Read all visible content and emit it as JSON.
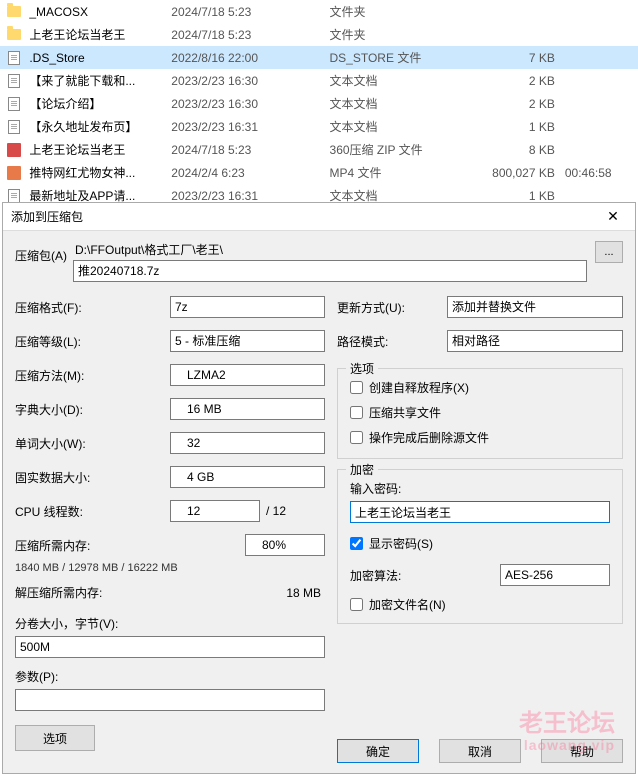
{
  "files": [
    {
      "icon": "folder",
      "name": "_MACOSX",
      "date": "2024/7/18 5:23",
      "type": "文件夹",
      "size": "",
      "dur": ""
    },
    {
      "icon": "folder",
      "name": "上老王论坛当老王",
      "date": "2024/7/18 5:23",
      "type": "文件夹",
      "size": "",
      "dur": ""
    },
    {
      "icon": "doc",
      "name": ".DS_Store",
      "date": "2022/8/16 22:00",
      "type": "DS_STORE 文件",
      "size": "7 KB",
      "dur": "",
      "selected": true
    },
    {
      "icon": "doc",
      "name": "【来了就能下载和...",
      "date": "2023/2/23 16:30",
      "type": "文本文档",
      "size": "2 KB",
      "dur": ""
    },
    {
      "icon": "doc",
      "name": "【论坛介绍】",
      "date": "2023/2/23 16:30",
      "type": "文本文档",
      "size": "2 KB",
      "dur": ""
    },
    {
      "icon": "doc",
      "name": "【永久地址发布页】",
      "date": "2023/2/23 16:31",
      "type": "文本文档",
      "size": "1 KB",
      "dur": ""
    },
    {
      "icon": "zip",
      "name": "上老王论坛当老王",
      "date": "2024/7/18 5:23",
      "type": "360压缩 ZIP 文件",
      "size": "8 KB",
      "dur": ""
    },
    {
      "icon": "mp4",
      "name": "推特网红尤物女神...",
      "date": "2024/2/4 6:23",
      "type": "MP4 文件",
      "size": "800,027 KB",
      "dur": "00:46:58"
    },
    {
      "icon": "doc",
      "name": "最新地址及APP请...",
      "date": "2023/2/23 16:31",
      "type": "文本文档",
      "size": "1 KB",
      "dur": ""
    }
  ],
  "dialog": {
    "title": "添加到压缩包",
    "archive_label": "压缩包(A)",
    "archive_path": "D:\\FFOutput\\格式工厂\\老王\\",
    "archive_name": "推20240718.7z",
    "browse": "...",
    "format_label": "压缩格式(F):",
    "format_value": "7z",
    "level_label": "压缩等级(L):",
    "level_value": "5 - 标准压缩",
    "method_label": "压缩方法(M):",
    "method_value": "LZMA2",
    "dict_label": "字典大小(D):",
    "dict_value": "16 MB",
    "word_label": "单词大小(W):",
    "word_value": "32",
    "solid_label": "固实数据大小:",
    "solid_value": "4 GB",
    "cpu_label": "CPU 线程数:",
    "cpu_value": "12",
    "cpu_max": "/ 12",
    "mem_comp_label": "压缩所需内存:",
    "mem_comp_value": "80%",
    "mem_comp_text": "1840 MB / 12978 MB / 16222 MB",
    "mem_decomp_label": "解压缩所需内存:",
    "mem_decomp_value": "18 MB",
    "split_label": "分卷大小，字节(V):",
    "split_value": "500M",
    "param_label": "参数(P):",
    "param_value": "",
    "options_btn": "选项",
    "update_label": "更新方式(U):",
    "update_value": "添加并替换文件",
    "pathmode_label": "路径模式:",
    "pathmode_value": "相对路径",
    "opts_title": "选项",
    "opt_sfx": "创建自释放程序(X)",
    "opt_share": "压缩共享文件",
    "opt_delete": "操作完成后删除源文件",
    "enc_title": "加密",
    "pw_label": "输入密码:",
    "pw_value": "上老王论坛当老王",
    "show_pw": "显示密码(S)",
    "enc_algo_label": "加密算法:",
    "enc_algo_value": "AES-256",
    "enc_names": "加密文件名(N)",
    "btn_ok": "确定",
    "btn_cancel": "取消",
    "btn_help": "帮助"
  },
  "watermark": {
    "line1": "老王论坛",
    "line2": "laowang.vip"
  }
}
